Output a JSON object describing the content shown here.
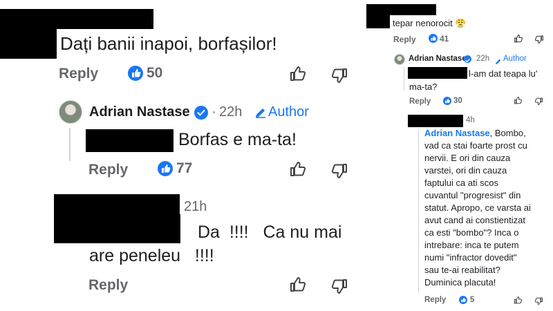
{
  "left_panel": {
    "comment1": {
      "text": "Dați banii inapoi, borfașilor!",
      "reply_label": "Reply",
      "like_count": "50"
    },
    "comment2": {
      "author": "Adrian Nastase",
      "time": "22h",
      "author_badge": "Author",
      "text": "Borfas e ma-ta!",
      "reply_label": "Reply",
      "like_count": "77"
    },
    "comment3": {
      "time": "21h",
      "line1": "Da  !!!!   Ca nu mai",
      "line2": "are peneleu   !!!!",
      "reply_label": "Reply"
    }
  },
  "right_panel": {
    "comment1": {
      "text": "tepar nenorocit",
      "emoji": "😤",
      "reply_label": "Reply",
      "like_count": "41"
    },
    "comment2": {
      "author": "Adrian Nastase",
      "time": "22h",
      "author_badge": "Author",
      "text_line1": "l-am dat teapa lu'",
      "text_line2": "ma-ta?",
      "reply_label": "Reply",
      "like_count": "30"
    },
    "comment3": {
      "time": "4h",
      "mention": "Adrian Nastase",
      "first_line_rest": ", Bombo,",
      "lines": [
        "vad ca stai foarte prost cu",
        "nervii. E ori din cauza",
        "varstei, ori din cauza",
        "faptului ca ati scos",
        "cuvantul \"progresist\" din",
        "statut. Apropo, ce varsta ai",
        "avut cand ai constientizat",
        "ca esti \"bombo\"? Inca o",
        "intrebare: inca te putem",
        "numi \"infractor dovedit\"",
        "sau te-ai reabilitat?",
        "Duminica placuta!"
      ],
      "reply_label": "Reply",
      "like_count": "5"
    }
  },
  "colors": {
    "accent": "#1877f2",
    "muted": "#65676b",
    "redaction": "#000000"
  },
  "icons": [
    "like-badge-icon",
    "thumbs-up-icon",
    "thumbs-down-icon",
    "verified-icon",
    "pencil-icon"
  ]
}
